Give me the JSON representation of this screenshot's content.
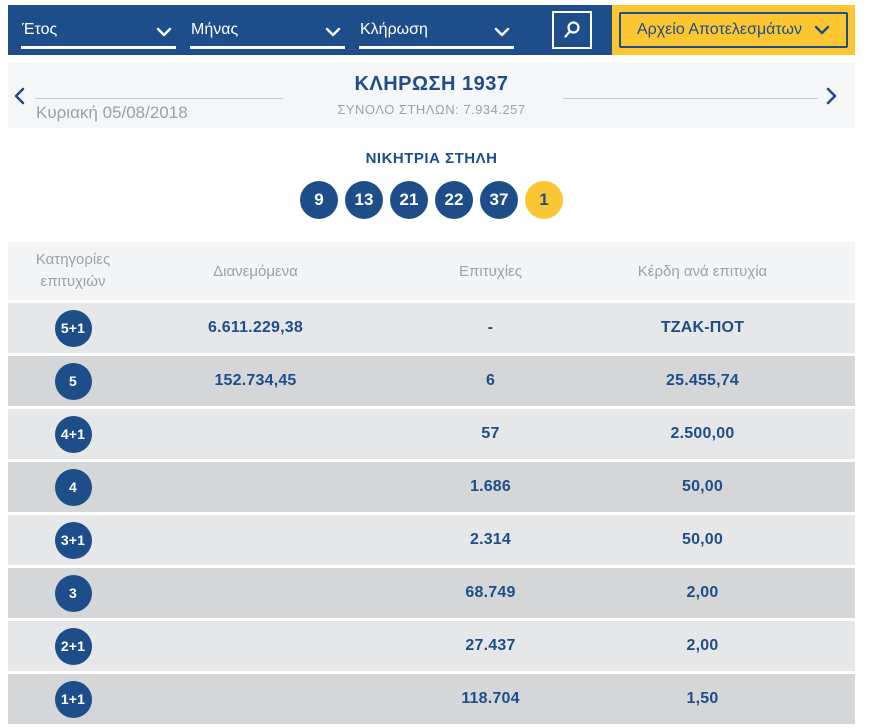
{
  "colors": {
    "brand_blue": "#1d4e89",
    "brand_yellow": "#fcc633",
    "muted_gray_text": "#9aa1ab",
    "row_light": "#e6e7e9",
    "row_dark": "#d4d6d8",
    "section_bg": "#f5f6f7"
  },
  "icons": {
    "search": "magnifier-icon",
    "dropdown": "chevron-down-icon",
    "archive": "chevron-down-icon",
    "previous": "chevron-left-icon",
    "next": "chevron-right-icon"
  },
  "filter_bar": {
    "dropdowns": [
      {
        "label": "Έτος"
      },
      {
        "label": "Μήνας"
      },
      {
        "label": "Κλήρωση"
      }
    ],
    "archive_button_label": "Αρχείο Αποτελεσμάτων"
  },
  "draw_nav": {
    "date": "Κυριακή 05/08/2018",
    "title": "ΚΛΗΡΩΣΗ 1937",
    "subtitle": "ΣΥΝΟΛΟ ΣΤΗΛΩΝ: 7.934.257"
  },
  "winning_column": {
    "title": "ΝΙΚΗΤΡΙΑ ΣΤΗΛΗ",
    "numbers": [
      "9",
      "13",
      "21",
      "22",
      "37"
    ],
    "bonus_number": "1"
  },
  "results_table": {
    "headers": {
      "category": "Κατηγορίες επιτυχιών",
      "distributed": "Διανεμόμενα",
      "winners": "Επιτυχίες",
      "payout": "Κέρδη ανά επιτυχία"
    },
    "rows": [
      {
        "category": "5+1",
        "distributed": "6.611.229,38",
        "winners": "-",
        "payout": "ΤΖΑΚ-ΠΟΤ"
      },
      {
        "category": "5",
        "distributed": "152.734,45",
        "winners": "6",
        "payout": "25.455,74"
      },
      {
        "category": "4+1",
        "distributed": "",
        "winners": "57",
        "payout": "2.500,00"
      },
      {
        "category": "4",
        "distributed": "",
        "winners": "1.686",
        "payout": "50,00"
      },
      {
        "category": "3+1",
        "distributed": "",
        "winners": "2.314",
        "payout": "50,00"
      },
      {
        "category": "3",
        "distributed": "",
        "winners": "68.749",
        "payout": "2,00"
      },
      {
        "category": "2+1",
        "distributed": "",
        "winners": "27.437",
        "payout": "2,00"
      },
      {
        "category": "1+1",
        "distributed": "",
        "winners": "118.704",
        "payout": "1,50"
      }
    ]
  }
}
